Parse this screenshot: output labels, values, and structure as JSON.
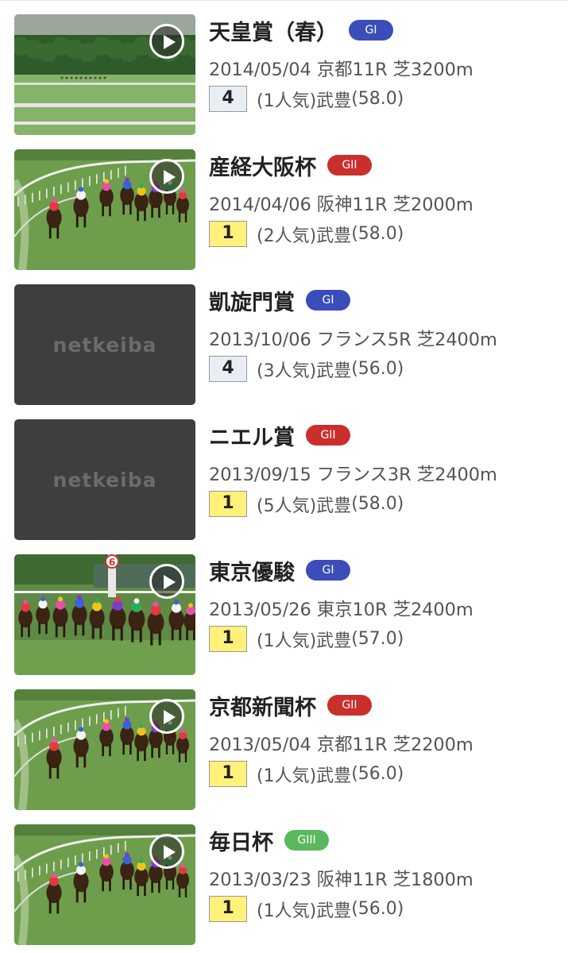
{
  "colors": {
    "grade_G1": "#3a4db8",
    "grade_G2": "#c9302c",
    "grade_G3": "#5cb85c",
    "finish_win": "#fff17a",
    "finish_other": "#e8eef4",
    "placeholder_bg": "#3e3e3e"
  },
  "races": [
    {
      "name": "天皇賞（春）",
      "grade": "GI",
      "grade_class": "G1",
      "date": "2014/05/04",
      "venue_race": "京都11R",
      "course": "芝3200m",
      "finish": "4",
      "finish_kind": "other",
      "popularity": "(1人気)",
      "jockey": "武豊",
      "weight": "(58.0)",
      "thumb": "video",
      "scene": "distant"
    },
    {
      "name": "産経大阪杯",
      "grade": "GII",
      "grade_class": "G2",
      "date": "2014/04/06",
      "venue_race": "阪神11R",
      "course": "芝2000m",
      "finish": "1",
      "finish_kind": "win",
      "popularity": "(2人気)",
      "jockey": "武豊",
      "weight": "(58.0)",
      "thumb": "video",
      "scene": "turn"
    },
    {
      "name": "凱旋門賞",
      "grade": "GI",
      "grade_class": "G1",
      "date": "2013/10/06",
      "venue_race": "フランス5R",
      "course": "芝2400m",
      "finish": "4",
      "finish_kind": "other",
      "popularity": "(3人気)",
      "jockey": "武豊",
      "weight": "(56.0)",
      "thumb": "placeholder",
      "placeholder_text": "netkeiba"
    },
    {
      "name": "ニエル賞",
      "grade": "GII",
      "grade_class": "G2",
      "date": "2013/09/15",
      "venue_race": "フランス3R",
      "course": "芝2400m",
      "finish": "1",
      "finish_kind": "win",
      "popularity": "(5人気)",
      "jockey": "武豊",
      "weight": "(58.0)",
      "thumb": "placeholder",
      "placeholder_text": "netkeiba"
    },
    {
      "name": "東京優駿",
      "grade": "GI",
      "grade_class": "G1",
      "date": "2013/05/26",
      "venue_race": "東京10R",
      "course": "芝2400m",
      "finish": "1",
      "finish_kind": "win",
      "popularity": "(1人気)",
      "jockey": "武豊",
      "weight": "(57.0)",
      "thumb": "video",
      "scene": "pack",
      "pole_number": "6"
    },
    {
      "name": "京都新聞杯",
      "grade": "GII",
      "grade_class": "G2",
      "date": "2013/05/04",
      "venue_race": "京都11R",
      "course": "芝2200m",
      "finish": "1",
      "finish_kind": "win",
      "popularity": "(1人気)",
      "jockey": "武豊",
      "weight": "(56.0)",
      "thumb": "video",
      "scene": "turn"
    },
    {
      "name": "毎日杯",
      "grade": "GIII",
      "grade_class": "G3",
      "date": "2013/03/23",
      "venue_race": "阪神11R",
      "course": "芝1800m",
      "finish": "1",
      "finish_kind": "win",
      "popularity": "(1人気)",
      "jockey": "武豊",
      "weight": "(56.0)",
      "thumb": "video",
      "scene": "turn"
    }
  ]
}
